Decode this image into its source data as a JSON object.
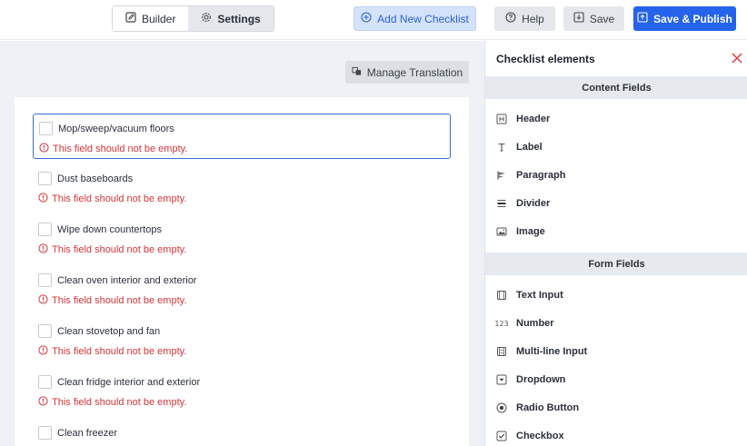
{
  "toolbar": {
    "builder_label": "Builder",
    "settings_label": "Settings",
    "add_label": "Add New Checklist",
    "help_label": "Help",
    "save_label": "Save",
    "publish_label": "Save & Publish"
  },
  "canvas": {
    "manage_translation_label": "Manage Translation",
    "items": [
      {
        "label": "Mop/sweep/vacuum floors",
        "error": "This field should not be empty."
      },
      {
        "label": "Dust baseboards",
        "error": "This field should not be empty."
      },
      {
        "label": "Wipe down countertops",
        "error": "This field should not be empty."
      },
      {
        "label": "Clean oven interior and exterior",
        "error": "This field should not be empty."
      },
      {
        "label": "Clean stovetop and fan",
        "error": "This field should not be empty."
      },
      {
        "label": "Clean fridge interior and exterior",
        "error": "This field should not be empty."
      },
      {
        "label": "Clean freezer",
        "error": ""
      }
    ]
  },
  "sidebar": {
    "title": "Checklist elements",
    "content_fields_label": "Content Fields",
    "form_fields_label": "Form Fields",
    "content_fields": [
      {
        "label": "Header",
        "icon": "header-icon",
        "glyph": "H"
      },
      {
        "label": "Label",
        "icon": "label-icon",
        "glyph": "T"
      },
      {
        "label": "Paragraph",
        "icon": "paragraph-icon",
        "glyph": ""
      },
      {
        "label": "Divider",
        "icon": "divider-icon",
        "glyph": ""
      },
      {
        "label": "Image",
        "icon": "image-icon",
        "glyph": ""
      }
    ],
    "form_fields": [
      {
        "label": "Text Input",
        "icon": "text-input-icon",
        "glyph": ""
      },
      {
        "label": "Number",
        "icon": "number-icon",
        "glyph": "123"
      },
      {
        "label": "Multi-line Input",
        "icon": "multiline-input-icon",
        "glyph": ""
      },
      {
        "label": "Dropdown",
        "icon": "dropdown-icon",
        "glyph": ""
      },
      {
        "label": "Radio Button",
        "icon": "radio-button-icon",
        "glyph": ""
      },
      {
        "label": "Checkbox",
        "icon": "checkbox-icon",
        "glyph": ""
      }
    ]
  },
  "colors": {
    "primary": "#2563eb",
    "error": "#d3363a",
    "accent_light": "#d5e2fb"
  }
}
